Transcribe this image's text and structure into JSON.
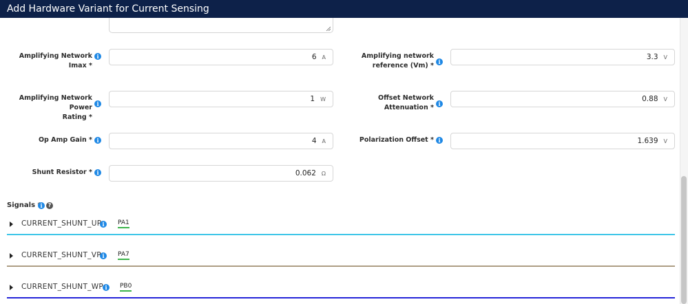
{
  "window": {
    "title": "Add Hardware Variant for Current Sensing"
  },
  "fields": {
    "amp_imax": {
      "label": "Amplifying Network Imax *",
      "value": "6",
      "unit": "A"
    },
    "amp_ref": {
      "label_line1": "Amplifying network",
      "label_line2": "reference (Vm) *",
      "value": "3.3",
      "unit": "V"
    },
    "amp_power": {
      "label_line1": "Amplifying Network Power",
      "label_line2": "Rating *",
      "value": "1",
      "unit": "W"
    },
    "offset_att": {
      "label_line1": "Offset Network",
      "label_line2": "Attenuation *",
      "value": "0.88",
      "unit": "V"
    },
    "opamp_gain": {
      "label": "Op Amp Gain *",
      "value": "4",
      "unit": "A"
    },
    "polar_offset": {
      "label": "Polarization Offset *",
      "value": "1.639",
      "unit": "V"
    },
    "shunt": {
      "label": "Shunt Resistor *",
      "value": "0.062",
      "unit": "Ω"
    }
  },
  "signals": {
    "label": "Signals *",
    "items": [
      {
        "name": "CURRENT_SHUNT_UP",
        "pin": "PA1",
        "color": "#3fc6e8"
      },
      {
        "name": "CURRENT_SHUNT_VP",
        "pin": "PA7",
        "color": "#ad9d83"
      },
      {
        "name": "CURRENT_SHUNT_WP",
        "pin": "PB0",
        "color": "#2424d8"
      }
    ]
  },
  "icons": {
    "info": "i",
    "help": "?"
  },
  "colors": {
    "titlebar": "#0d2149",
    "info": "#1e88e5",
    "pin_underline": "#3bb34a"
  }
}
